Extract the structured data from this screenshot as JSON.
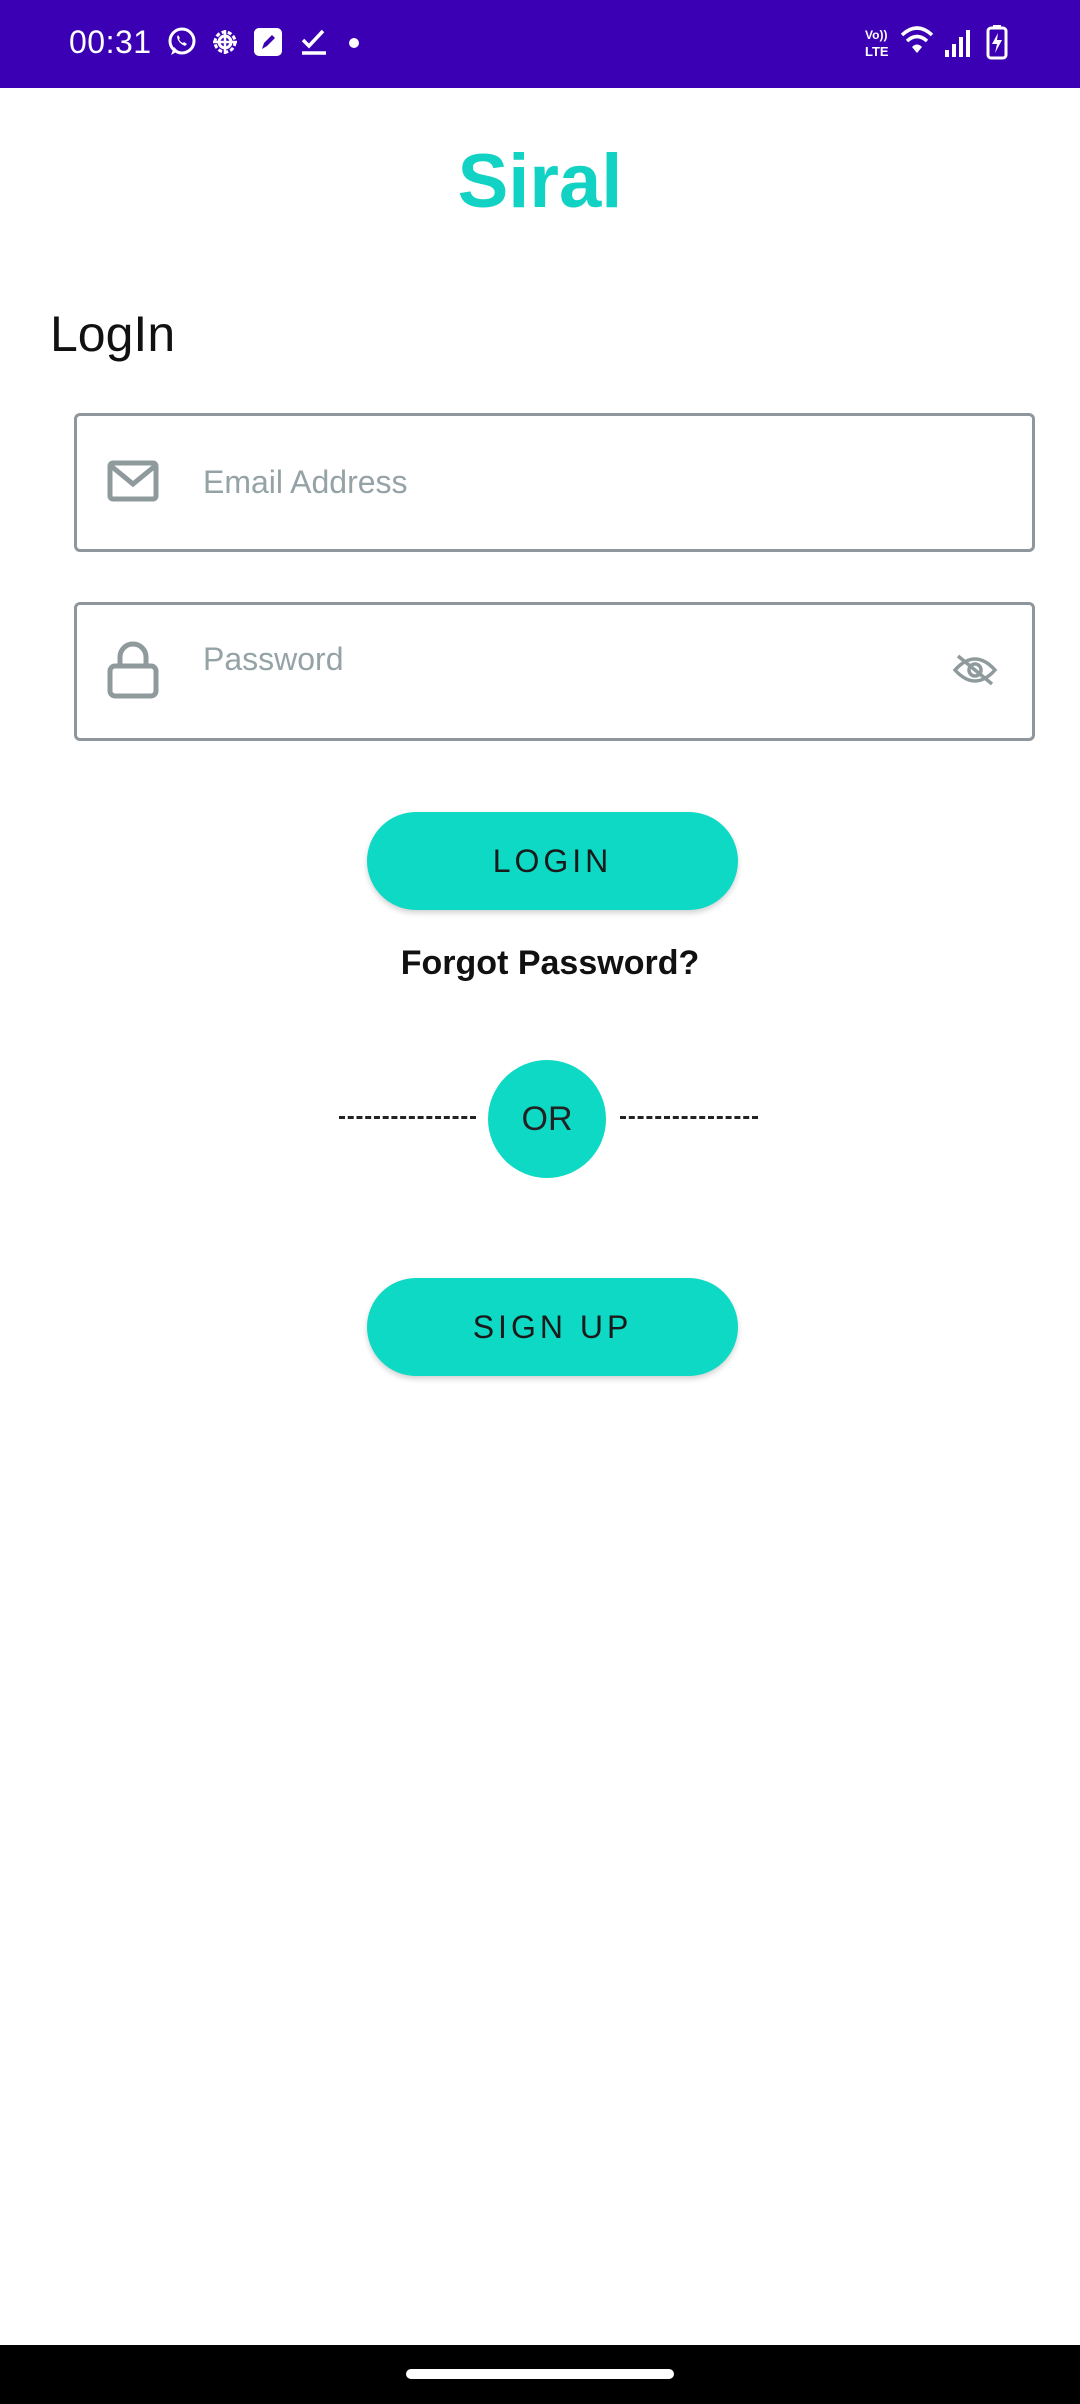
{
  "status_bar": {
    "time": "00:31",
    "left_icons": [
      "whatsapp-icon",
      "settings-gear-icon",
      "pencil-note-icon",
      "checklist-icon",
      "dot-icon"
    ],
    "right_icons": [
      "volte-icon",
      "wifi-icon",
      "signal-icon",
      "battery-charging-icon"
    ],
    "volte_top": "Vo))",
    "volte_bottom": "LTE",
    "background": "#3B00B4"
  },
  "app": {
    "title": "Siral",
    "accent_color": "#12D3C3"
  },
  "login": {
    "heading": "LogIn",
    "email": {
      "placeholder": "Email Address",
      "value": "",
      "icon": "mail-icon"
    },
    "password": {
      "placeholder": "Password",
      "value": "",
      "icon": "lock-icon",
      "toggle_icon": "eye-off-icon"
    },
    "login_button": "LOGIN",
    "forgot_password": "Forgot Password?",
    "or_label": "OR",
    "signup_button": "SIGN UP",
    "button_color": "#0DD9C5"
  }
}
